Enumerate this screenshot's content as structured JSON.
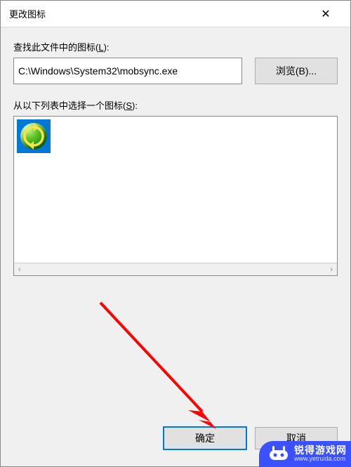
{
  "titlebar": {
    "title": "更改图标"
  },
  "labels": {
    "lookfor": "查找此文件中的图标(",
    "lookfor_key": "L",
    "lookfor_suffix": "):",
    "select": "从以下列表中选择一个图标(",
    "select_key": "S",
    "select_suffix": "):"
  },
  "path": {
    "value": "C:\\Windows\\System32\\mobsync.exe"
  },
  "buttons": {
    "browse": "浏览(B)...",
    "ok": "确定",
    "cancel": "取消"
  },
  "icons": {
    "selected": "sync-icon"
  },
  "scroll": {
    "left": "‹",
    "right": "›"
  },
  "watermark": {
    "line1": "锐得游戏网",
    "line2": "www.yetruida.com"
  }
}
